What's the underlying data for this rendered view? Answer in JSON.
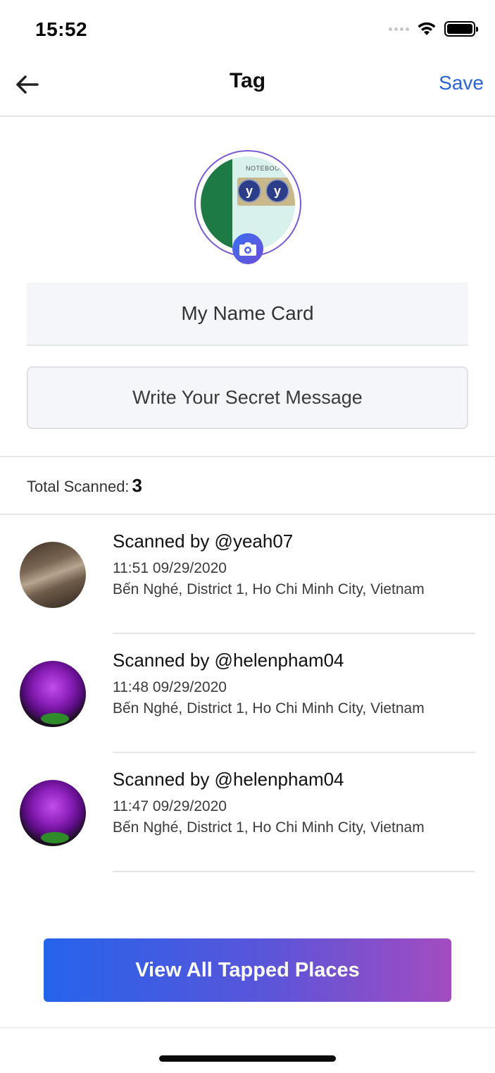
{
  "status": {
    "time": "15:52"
  },
  "nav": {
    "title": "Tag",
    "save_label": "Save"
  },
  "profile": {
    "name": "My Name Card",
    "secret_placeholder": "Write Your Secret Message",
    "avatar_text": "NOTEBOOK"
  },
  "stats": {
    "total_label": "Total Scanned:",
    "total_value": "3"
  },
  "scans": [
    {
      "title": "Scanned by @yeah07",
      "time": "11:51 09/29/2020",
      "location": "Bến Nghé, District 1, Ho Chi Minh City, Vietnam",
      "avatar": "wood-texture"
    },
    {
      "title": "Scanned by @helenpham04",
      "time": "11:48 09/29/2020",
      "location": "Bến Nghé, District 1, Ho Chi Minh City, Vietnam",
      "avatar": "purple-rose"
    },
    {
      "title": "Scanned by @helenpham04",
      "time": "11:47 09/29/2020",
      "location": "Bến Nghé, District 1, Ho Chi Minh City, Vietnam",
      "avatar": "purple-rose"
    }
  ],
  "cta": {
    "label": "View All Tapped Places"
  },
  "colors": {
    "accent": "#2b63d6",
    "gradient_start": "#2563eb",
    "gradient_end": "#a44cc0"
  }
}
